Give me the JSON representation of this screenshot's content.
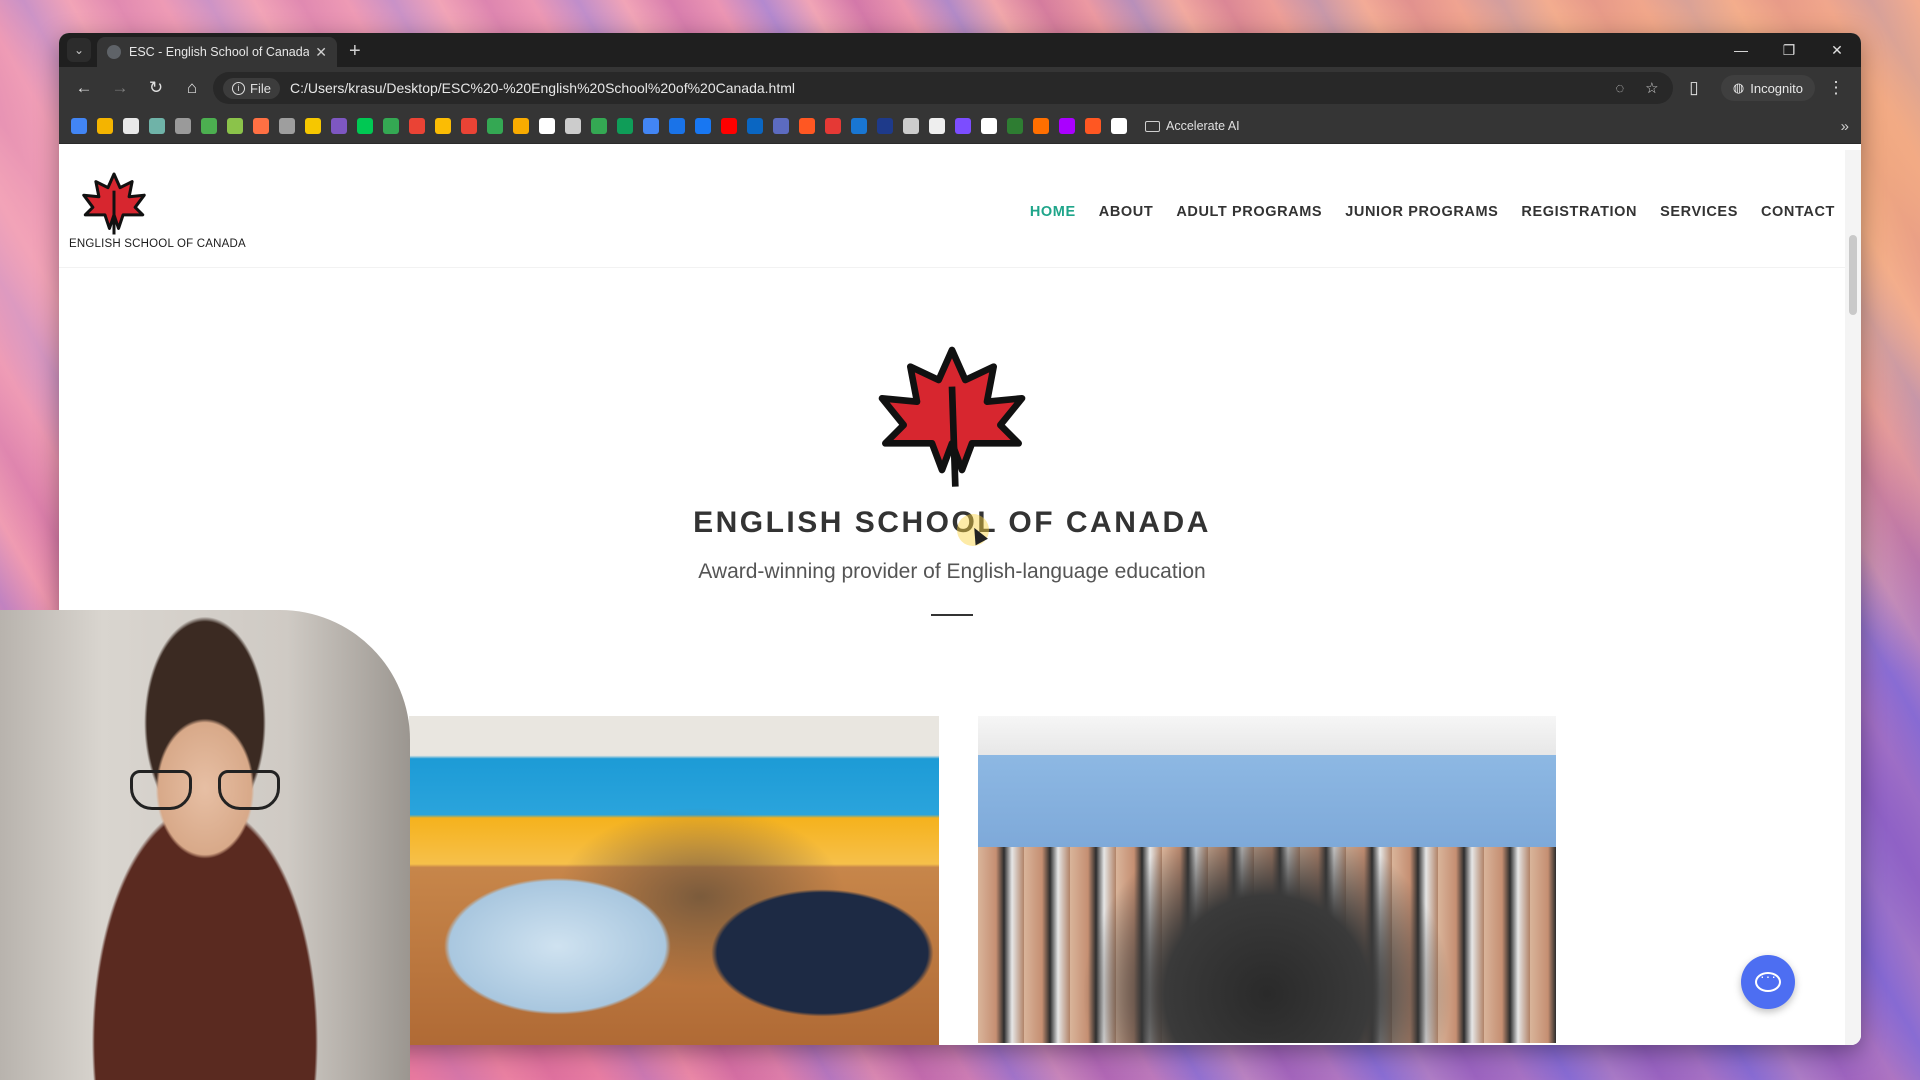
{
  "browser": {
    "tab_title": "ESC - English School of Canada",
    "file_label": "File",
    "url": "C:/Users/krasu/Desktop/ESC%20-%20English%20School%20of%20Canada.html",
    "incognito_label": "Incognito",
    "bookmark_folder": "Accelerate AI",
    "bookmark_icon_colors": [
      "#4285f4",
      "#f4b400",
      "#e8e8e8",
      "#6fb3a8",
      "#9a9a9a",
      "#4caf50",
      "#8bc34a",
      "#ff7043",
      "#9e9e9e",
      "#f6c700",
      "#7e57c2",
      "#00c853",
      "#34a853",
      "#ea4335",
      "#fbbc04",
      "#ea4335",
      "#34a853",
      "#f9ab00",
      "#ffffff",
      "#cccccc",
      "#34a853",
      "#0f9d58",
      "#4285f4",
      "#1a73e8",
      "#1877f2",
      "#ff0000",
      "#0a66c2",
      "#5c6bc0",
      "#ff5722",
      "#e53935",
      "#1976d2",
      "#1e3a8a",
      "#cccccc",
      "#eeeeee",
      "#7c4dff",
      "#ffffff",
      "#2e7d32",
      "#ff6f00",
      "#aa00ff",
      "#ff5722",
      "#ffffff"
    ]
  },
  "site": {
    "brand_name": "ENGLISH SCHOOL OF CANADA",
    "nav": [
      "HOME",
      "ABOUT",
      "ADULT PROGRAMS",
      "JUNIOR PROGRAMS",
      "REGISTRATION",
      "SERVICES",
      "CONTACT"
    ],
    "active_nav": "HOME",
    "accent_color": "#1fa58a",
    "leaf_color": "#d7262f",
    "hero_title": "ENGLISH SCHOOL OF CANADA",
    "hero_subtitle": "Award-winning provider of English-language education",
    "chat_button_color": "#4d6ef2"
  }
}
